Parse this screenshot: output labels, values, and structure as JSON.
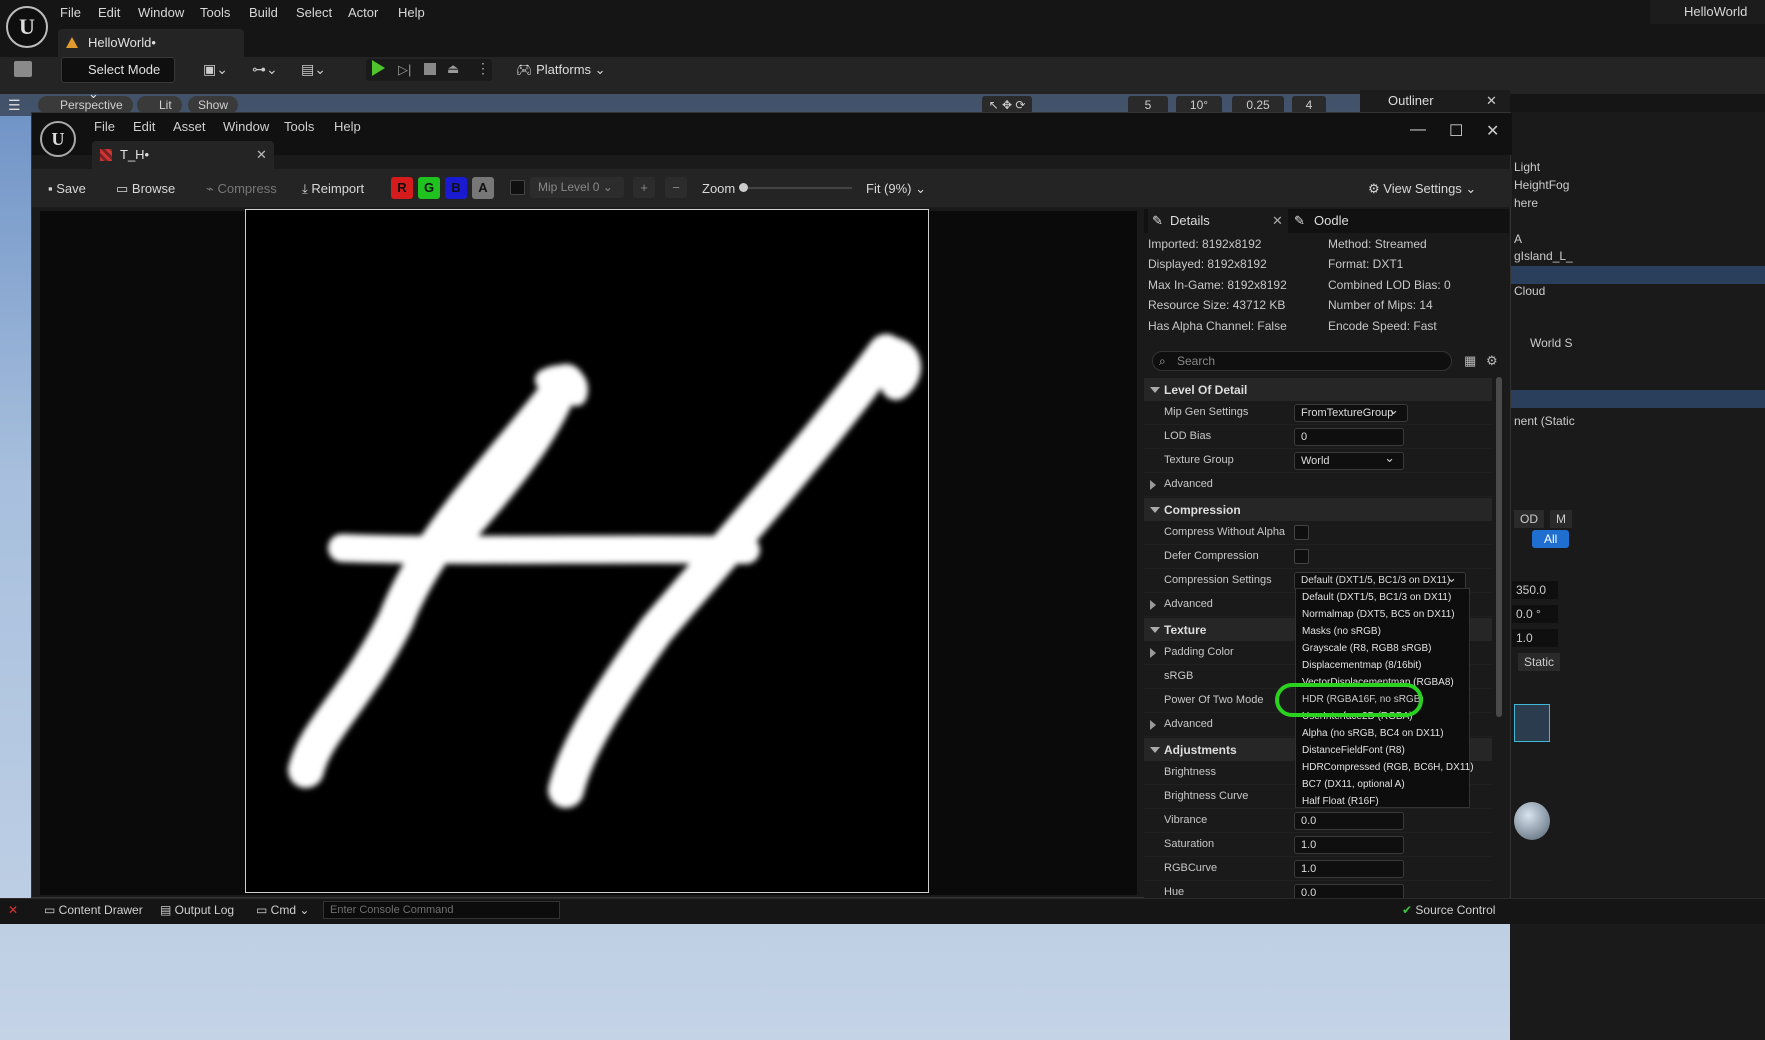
{
  "main_menu": [
    "File",
    "Edit",
    "Window",
    "Tools",
    "Build",
    "Select",
    "Actor",
    "Help"
  ],
  "project_tab": "HelloWorld•",
  "project_name_right": "HelloWorld",
  "toolbar": {
    "select_mode": "Select Mode",
    "platforms": "Platforms"
  },
  "viewport": {
    "perspective": "Perspective",
    "lit": "Lit",
    "show": "Show",
    "grid_snap": "5",
    "rot_snap": "10°",
    "scale_snap": "0.25",
    "camera_speed": "4"
  },
  "outliner": {
    "title": "Outliner",
    "items": [
      "Light",
      "HeightFog",
      "here",
      "A",
      "gIsland_L_",
      "Cloud",
      "World S",
      "nent (Static",
      "OD",
      "M",
      "All",
      "350.0",
      "0.0 °",
      "1.0",
      "Static"
    ]
  },
  "texture_editor": {
    "menu": [
      "File",
      "Edit",
      "Asset",
      "Window",
      "Tools",
      "Help"
    ],
    "tab": "T_H•",
    "toolbar": {
      "save": "Save",
      "browse": "Browse",
      "compress": "Compress",
      "reimport": "Reimport",
      "r": "R",
      "g": "G",
      "b": "B",
      "a": "A",
      "mip": "Mip Level 0",
      "zoom": "Zoom",
      "fit": "Fit (9%)",
      "view_settings": "View Settings"
    }
  },
  "details": {
    "tab": "Details",
    "tab2": "Oodle",
    "info_left": [
      "Imported: 8192x8192",
      "Displayed: 8192x8192",
      "Max In-Game: 8192x8192",
      "Resource Size: 43712 KB",
      "Has Alpha Channel: False"
    ],
    "info_right": [
      "Method: Streamed",
      "Format: DXT1",
      "Combined LOD Bias: 0",
      "Number of Mips: 14",
      "Encode Speed: Fast"
    ],
    "search_placeholder": "Search",
    "lod": {
      "section": "Level Of Detail",
      "mip_gen_label": "Mip Gen Settings",
      "mip_gen": "FromTextureGroup",
      "lod_bias_label": "LOD Bias",
      "lod_bias": "0",
      "tex_group_label": "Texture Group",
      "tex_group": "World",
      "advanced": "Advanced"
    },
    "compression": {
      "section": "Compression",
      "compress_wo_alpha": "Compress Without Alpha",
      "defer": "Defer Compression",
      "settings_label": "Compression Settings",
      "settings": "Default (DXT1/5, BC1/3 on DX11)",
      "advanced": "Advanced"
    },
    "texture": {
      "section": "Texture",
      "padding": "Padding Color",
      "srgb": "sRGB",
      "pow2": "Power Of Two Mode",
      "advanced": "Advanced"
    },
    "adjustments": {
      "section": "Adjustments",
      "brightness": "Brightness",
      "brightness_curve": "Brightness Curve",
      "vibrance": "Vibrance",
      "vibrance_val": "0.0",
      "saturation": "Saturation",
      "saturation_val": "1.0",
      "rgbcurve": "RGBCurve",
      "rgbcurve_val": "1.0",
      "hue": "Hue",
      "hue_val": "0.0"
    }
  },
  "dropdown_options": [
    "Default (DXT1/5, BC1/3 on DX11)",
    "Normalmap (DXT5, BC5 on DX11)",
    "Masks (no sRGB)",
    "Grayscale (R8, RGB8 sRGB)",
    "Displacementmap (8/16bit)",
    "VectorDisplacementmap (RGBA8)",
    "HDR (RGBA16F, no sRGB)",
    "UserInterface2D (RGBA)",
    "Alpha (no sRGB, BC4 on DX11)",
    "DistanceFieldFont (R8)",
    "HDRCompressed (RGB, BC6H, DX11)",
    "BC7 (DX11, optional A)",
    "Half Float (R16F)"
  ],
  "highlighted_option": "HDR (RGBA16F, no sRGB)",
  "bottom": {
    "content_drawer": "Content Drawer",
    "output_log": "Output Log",
    "cmd": "Cmd",
    "console_placeholder": "Enter Console Command",
    "source_control": "Source Control"
  }
}
